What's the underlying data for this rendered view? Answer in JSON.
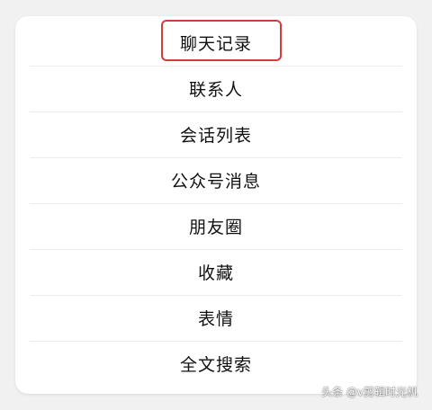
{
  "menu": {
    "items": [
      {
        "label": "聊天记录",
        "highlighted": true
      },
      {
        "label": "联系人"
      },
      {
        "label": "会话列表"
      },
      {
        "label": "公众号消息"
      },
      {
        "label": "朋友圈"
      },
      {
        "label": "收藏"
      },
      {
        "label": "表情"
      },
      {
        "label": "全文搜索"
      }
    ]
  },
  "highlight": {
    "color": "#d63b3b"
  },
  "watermark": {
    "text": "头条 @v剪辑时光机"
  }
}
